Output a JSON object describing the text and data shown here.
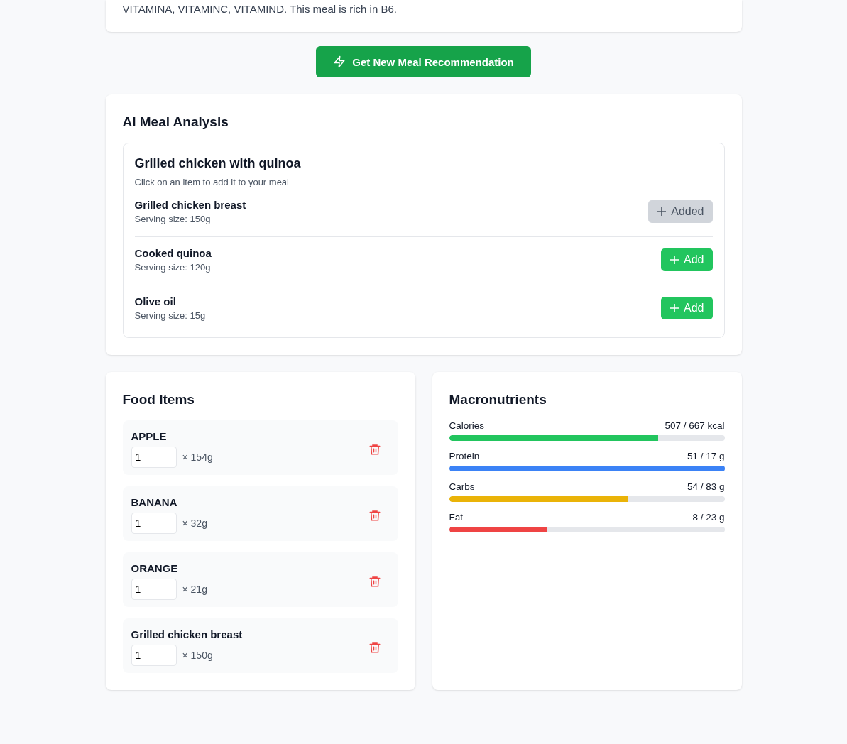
{
  "summary_card": {
    "text": "VITAMINA, VITAMINC, VITAMIND. This meal is rich in B6."
  },
  "recommend_button": {
    "label": "Get New Meal Recommendation"
  },
  "analysis": {
    "title": "AI Meal Analysis",
    "meal_name": "Grilled chicken with quinoa",
    "hint": "Click on an item to add it to your meal",
    "items": [
      {
        "name": "Grilled chicken breast",
        "serving": "Serving size: 150g",
        "button": "Added",
        "added": true
      },
      {
        "name": "Cooked quinoa",
        "serving": "Serving size: 120g",
        "button": "Add",
        "added": false
      },
      {
        "name": "Olive oil",
        "serving": "Serving size: 15g",
        "button": "Add",
        "added": false
      }
    ]
  },
  "food_items": {
    "title": "Food Items",
    "items": [
      {
        "name": "APPLE",
        "quantity": "1",
        "weight": "× 154g"
      },
      {
        "name": "BANANA",
        "quantity": "1",
        "weight": "× 32g"
      },
      {
        "name": "ORANGE",
        "quantity": "1",
        "weight": "× 21g"
      },
      {
        "name": "Grilled chicken breast",
        "quantity": "1",
        "weight": "× 150g"
      }
    ]
  },
  "macronutrients": {
    "title": "Macronutrients",
    "items": [
      {
        "label": "Calories",
        "reading": "507 / 667 kcal",
        "level": 0.76,
        "color": "#22c55e"
      },
      {
        "label": "Protein",
        "reading": "51 / 17 g",
        "level": 1,
        "color": "#3b82f6"
      },
      {
        "label": "Carbs",
        "reading": "54 / 83 g",
        "level": 0.647,
        "color": "#eab308"
      },
      {
        "label": "Fat",
        "reading": "8 / 23 g",
        "level": 0.358,
        "color": "#ef4444"
      }
    ]
  }
}
